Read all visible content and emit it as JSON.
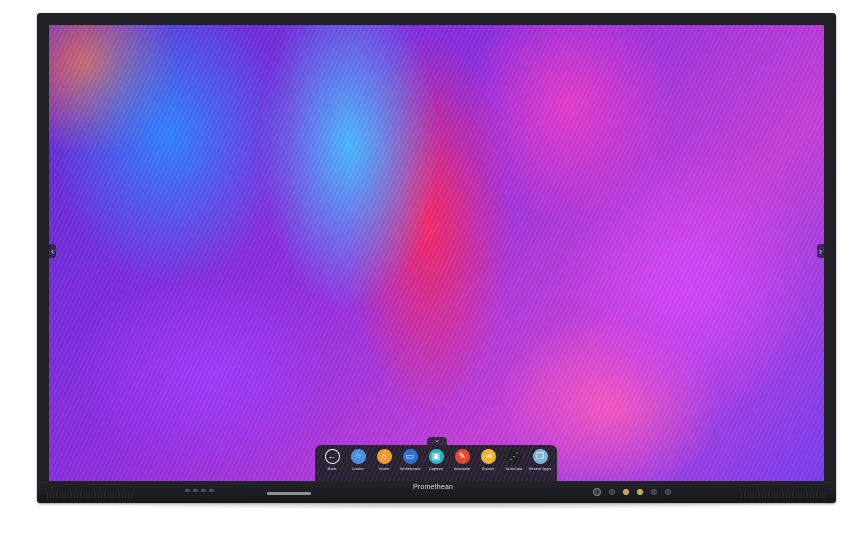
{
  "device": {
    "brand": "Promethean"
  },
  "dock": {
    "items": [
      {
        "id": "back",
        "label": "Back",
        "icon": "back-arrow-icon",
        "color": "#1c1e24",
        "glyph": "←"
      },
      {
        "id": "locker",
        "label": "Locker",
        "icon": "apps-locker-icon",
        "color": "#4a90e2",
        "glyph": "⁘"
      },
      {
        "id": "home",
        "label": "Home",
        "icon": "home-icon",
        "color": "#f39a2b",
        "glyph": "⌂"
      },
      {
        "id": "whiteboard",
        "label": "Whiteboard",
        "icon": "whiteboard-icon",
        "color": "#2c6fd6",
        "glyph": "▭"
      },
      {
        "id": "capture",
        "label": "Capture",
        "icon": "capture-icon",
        "color": "#2bb3c4",
        "glyph": "▣"
      },
      {
        "id": "annotate",
        "label": "Annotate",
        "icon": "annotate-pen-icon",
        "color": "#e8452f",
        "glyph": "✎"
      },
      {
        "id": "source",
        "label": "Source",
        "icon": "source-input-icon",
        "color": "#f2b531",
        "glyph": "⇥"
      },
      {
        "id": "autocast",
        "label": "AutoCast",
        "icon": "share-cast-icon",
        "color": "#1c1e24",
        "glyph": "⋰"
      },
      {
        "id": "recent-apps",
        "label": "Recent Apps",
        "icon": "recent-apps-icon",
        "color": "#7fb4d8",
        "glyph": "❐"
      }
    ]
  },
  "side_handles": {
    "left_glyph": "‹",
    "right_glyph": "›",
    "tab_glyph": "⌄"
  }
}
